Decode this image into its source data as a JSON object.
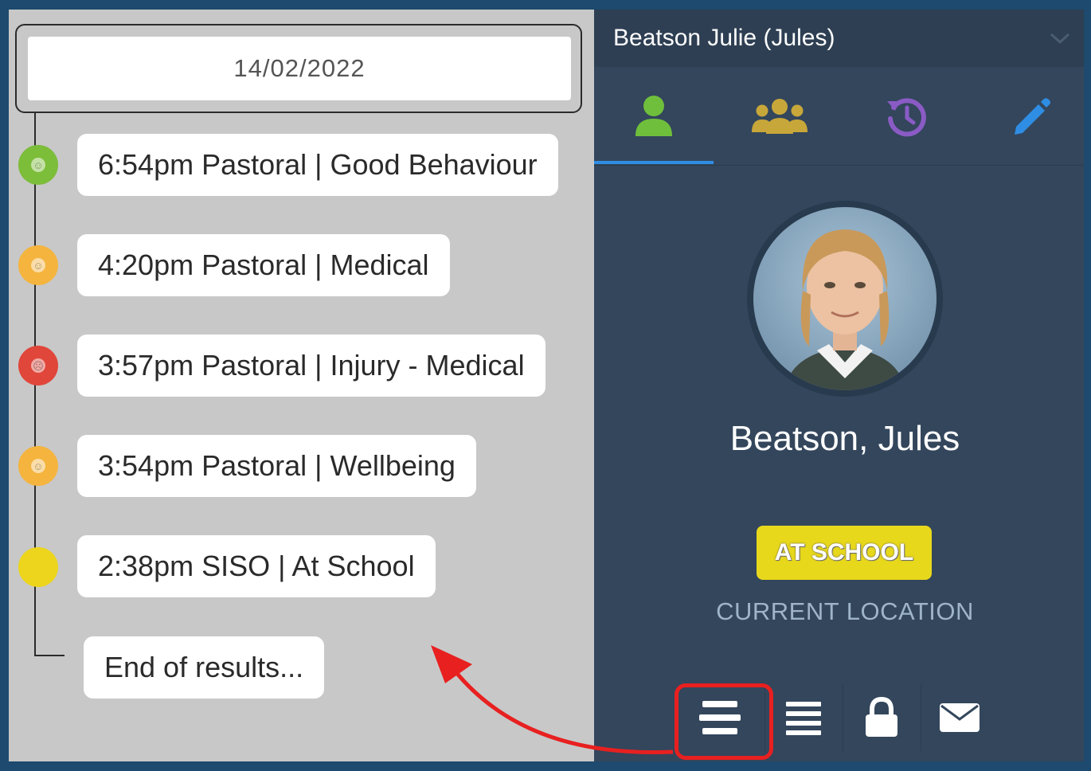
{
  "timeline": {
    "date": "14/02/2022",
    "entries": [
      {
        "label": "6:54pm Pastoral | Good Behaviour",
        "color": "#7cbd3a"
      },
      {
        "label": "4:20pm Pastoral | Medical",
        "color": "#f4b43e"
      },
      {
        "label": "3:57pm Pastoral | Injury - Medical",
        "color": "#e0463a"
      },
      {
        "label": "3:54pm Pastoral | Wellbeing",
        "color": "#f4b43e"
      },
      {
        "label": "2:38pm SISO | At School",
        "color": "#ecd51c"
      }
    ],
    "end_label": "End of results..."
  },
  "student_panel": {
    "header_title": "Beatson Julie (Jules)",
    "tabs": [
      {
        "icon": "user-icon",
        "color": "#6fbf3c",
        "active": true
      },
      {
        "icon": "users-icon",
        "color": "#c8a73a",
        "active": false
      },
      {
        "icon": "history-icon",
        "color": "#8a5bc4",
        "active": false
      },
      {
        "icon": "pencil-icon",
        "color": "#2f8de4",
        "active": false
      }
    ],
    "student_name": "Beatson, Jules",
    "location_status": "AT SCHOOL",
    "location_label": "CURRENT LOCATION",
    "bottom_actions": [
      {
        "icon": "timeline-icon"
      },
      {
        "icon": "list-icon"
      },
      {
        "icon": "lock-icon"
      },
      {
        "icon": "envelope-icon"
      }
    ]
  },
  "colors": {
    "annotation": "#e82020",
    "accent": "#2f8de4",
    "status_badge": "#e8d81c"
  }
}
